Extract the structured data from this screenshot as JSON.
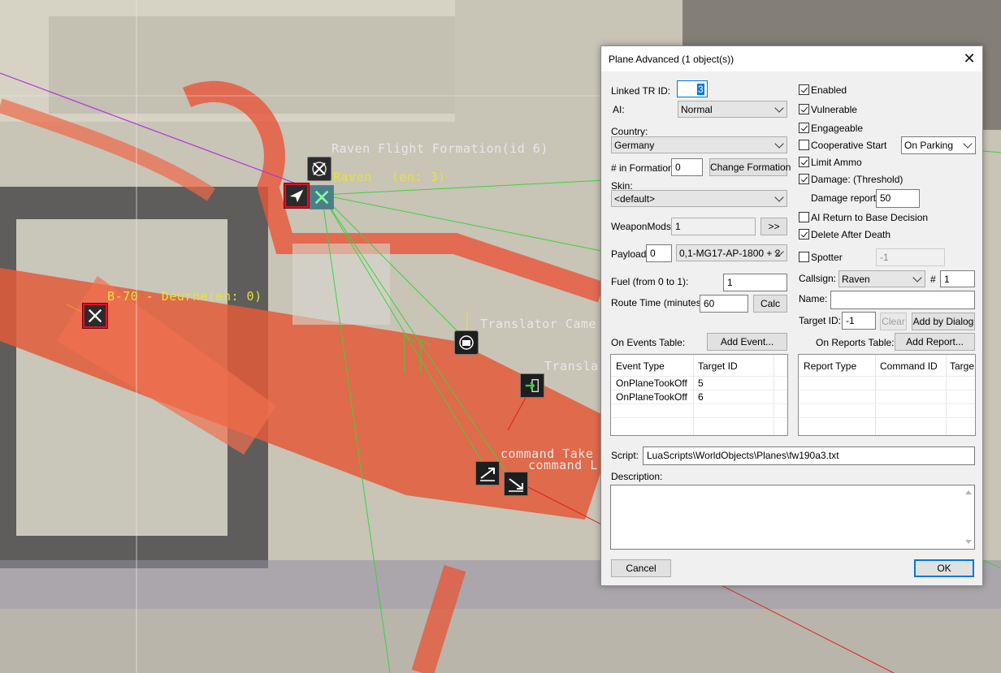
{
  "map": {
    "labels": {
      "raven_formation": "Raven Flight Formation(id 6)",
      "raven": "Raven",
      "raven_en": "(en: 3)",
      "b70": "B-70 - Deurne(en: 0)",
      "translator_camera": "Translator Came",
      "translator2": "Transla",
      "command_take": "command Take",
      "command_l": "command L"
    },
    "colors": {
      "route_green": "#3cd23c",
      "route_purple": "#b030e0",
      "route_red": "#e02020",
      "label_yellow": "#e6e23a",
      "label_white": "#e8e8e8"
    }
  },
  "dialog": {
    "title": "Plane Advanced (1 object(s))",
    "left": {
      "linked_tr_id_label": "Linked TR ID:",
      "linked_tr_id_value": "3",
      "ai_label": "AI:",
      "ai_value": "Normal",
      "country_label": "Country:",
      "country_value": "Germany",
      "in_formation_label": "# in Formation:",
      "in_formation_value": "0",
      "change_formation_button": "Change Formation",
      "skin_label": "Skin:",
      "skin_value": "<default>",
      "weaponmods_label": "WeaponMods:",
      "weaponmods_value": "1",
      "weaponmods_button": ">>",
      "payload_label": "Payload:",
      "payload_value": "0",
      "payload_select": "0,1-MG17-AP-1800 + 2",
      "fuel_label": "Fuel (from 0 to 1):",
      "fuel_value": "1",
      "route_time_label": "Route Time (minutes):",
      "route_time_value": "60",
      "calc_button": "Calc"
    },
    "right": {
      "enabled": {
        "label": "Enabled",
        "checked": true
      },
      "vulnerable": {
        "label": "Vulnerable",
        "checked": true
      },
      "engageable": {
        "label": "Engageable",
        "checked": true
      },
      "cooperative_start": {
        "label": "Cooperative Start",
        "checked": false
      },
      "cooperative_select": "On Parking",
      "limit_ammo": {
        "label": "Limit Ammo",
        "checked": true
      },
      "damage": {
        "label": "Damage: (Threshold)",
        "checked": true
      },
      "damage_report_label": "Damage report:",
      "damage_report_value": "50",
      "ai_return": {
        "label": "AI Return to Base Decision",
        "checked": false
      },
      "delete_after_death": {
        "label": "Delete After Death",
        "checked": true
      },
      "spotter": {
        "label": "Spotter",
        "checked": false
      },
      "spotter_value": "-1",
      "callsign_label": "Callsign:",
      "callsign_value": "Raven",
      "callsign_num_label": "#",
      "callsign_num_value": "1",
      "name_label": "Name:",
      "name_value": "",
      "target_id_label": "Target ID:",
      "target_id_value": "-1",
      "clear_button": "Clear",
      "add_by_dialog_button": "Add by Dialog"
    },
    "events": {
      "label": "On Events Table:",
      "add_button": "Add Event...",
      "columns": [
        "Event Type",
        "Target ID"
      ],
      "rows": [
        [
          "OnPlaneTookOff",
          "5"
        ],
        [
          "OnPlaneTookOff",
          "6"
        ]
      ]
    },
    "reports": {
      "label": "On Reports Table:",
      "add_button": "Add Report...",
      "columns": [
        "Report Type",
        "Command ID",
        "Targe"
      ]
    },
    "script_label": "Script:",
    "script_value": "LuaScripts\\WorldObjects\\Planes\\fw190a3.txt",
    "description_label": "Description:",
    "description_value": "",
    "cancel_button": "Cancel",
    "ok_button": "OK"
  }
}
